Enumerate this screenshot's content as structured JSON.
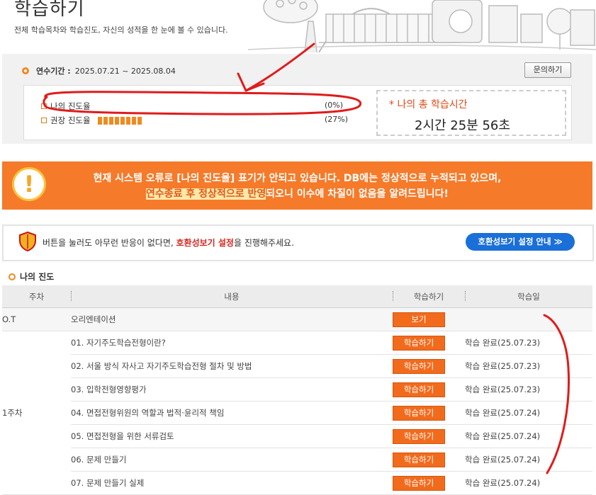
{
  "header": {
    "title": "학습하기",
    "subtitle": "전체 학습목차와 학습진도, 자신의 성적을 한 눈에 볼 수 있습니다."
  },
  "period": {
    "label": "연수기간 :",
    "value": "2025.07.21 ~ 2025.08.04",
    "inquiry_button": "문의하기"
  },
  "progress": {
    "my_label": "나의 진도율",
    "my_value": "(0%)",
    "recommended_label": "권장 진도율",
    "recommended_value": "(27%)",
    "recommended_fraction": 0.27,
    "time_label": "* 나의 총 학습시간",
    "time_value": "2시간 25분 56초"
  },
  "notice": {
    "line1": "현재 시스템 오류로 [나의 진도율] 표기가 안되고 있습니다. DB에는 정상적으로 누적되고 있으며,",
    "line2_highlight": "연수종료 후 정상적으로 반영",
    "line2_rest": "되오니 이수에 차질이 없음을 알려드립니다!",
    "accent": "#f57a29"
  },
  "compat": {
    "text_before": "버튼을 눌러도 아무런 반응이 없다면,",
    "text_highlight": "호환성보기 설정",
    "text_after": "을 진행해주세요.",
    "button": "호환성보기 설정 안내 ≫"
  },
  "my_progress": {
    "title": "나의 진도",
    "columns": [
      "주차",
      "내용",
      "학습하기",
      "학습일"
    ],
    "rows": [
      {
        "week": "O.T",
        "content": "오리엔테이션",
        "action": "보기",
        "date": ""
      },
      {
        "week": "",
        "content": "01. 자기주도학습전형이란?",
        "action": "학습하기",
        "date": "학습 완료(25.07.23)"
      },
      {
        "week": "",
        "content": "02. 서울 방식 자사고 자기주도학습전형 절차 및 방법",
        "action": "학습하기",
        "date": "학습 완료(25.07.23)"
      },
      {
        "week": "",
        "content": "03. 입학전형영향평가",
        "action": "학습하기",
        "date": "학습 완료(25.07.23)"
      },
      {
        "week": "",
        "content": "04. 면접전형위원의 역할과 법적·윤리적 책임",
        "action": "학습하기",
        "date": "학습 완료(25.07.24)"
      },
      {
        "week": "1주차",
        "content": "05. 면접전형을 위한 서류검토",
        "action": "학습하기",
        "date": "학습 완료(25.07.24)"
      },
      {
        "week": "",
        "content": "06. 문제 만들기",
        "action": "학습하기",
        "date": "학습 완료(25.07.24)"
      },
      {
        "week": "",
        "content": "07. 문제 만들기 실제",
        "action": "학습하기",
        "date": "학습 완료(25.07.24)"
      }
    ]
  }
}
